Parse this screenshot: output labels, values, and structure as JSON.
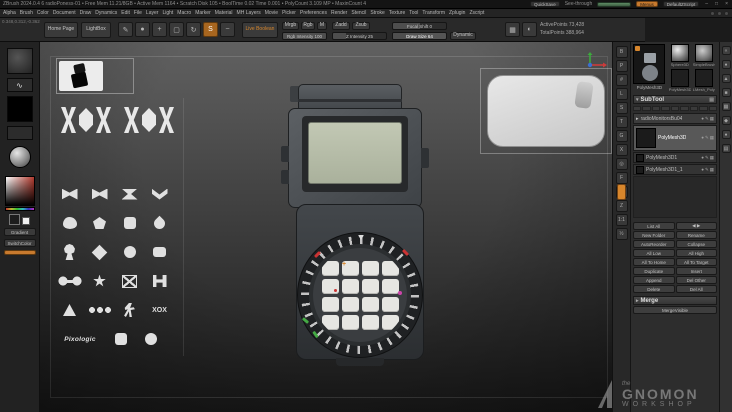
{
  "colors": {
    "accent_orange": "#d7862c",
    "screen_green": "#b8bfab",
    "canvas_top": "#616161",
    "canvas_bottom": "#191919",
    "selection_white": "#e8e8e8",
    "tick_red": "#cc3333",
    "tick_green": "#44aa44",
    "tick_magenta": "#cc44aa"
  },
  "title_bar": {
    "app_info": "ZBrush 2024.0.4 6 radioPoness-01  •  Free Mem 11.21/8GB  •  Active Mem 1164  •  Scratch Disk 105  •  BoolTime 0.02 Time 0.001  •  PolyCount 3.109 MP  •  MaxinCount 4",
    "quicksave": "QuickSave",
    "see_through_label": "See-through",
    "menus_toggle": "Menus",
    "zscript_button": "DefaultZScript",
    "window_minimize": "–",
    "window_maximize": "□",
    "window_close": "×"
  },
  "coords_readout": "0.348,0.312,-0.362",
  "menu_bar": {
    "items": [
      "Alpha",
      "Brush",
      "Color",
      "Document",
      "Draw",
      "Dynamics",
      "Edit",
      "File",
      "Layer",
      "Light",
      "Macro",
      "Marker",
      "Material",
      "MH Layers",
      "Movie",
      "Picker",
      "Preferences",
      "Render",
      "Stencil",
      "Stroke",
      "Texture",
      "Tool",
      "Transform",
      "Zplugin",
      "Zscript"
    ]
  },
  "toolbar": {
    "home_page": "Home Page",
    "lightbox": "LightBox",
    "live_boolean": "Live Boolean",
    "icons": [
      {
        "name": "edit-icon",
        "glyph": "✎"
      },
      {
        "name": "draw-icon",
        "glyph": "●"
      },
      {
        "name": "move-icon",
        "glyph": "+"
      },
      {
        "name": "scale-icon",
        "glyph": "▢"
      },
      {
        "name": "rotate-icon",
        "glyph": "↻"
      },
      {
        "name": "sculptris-icon",
        "glyph": "S",
        "accent": true
      },
      {
        "name": "stroke-icon",
        "glyph": "~"
      }
    ],
    "mrgb": "Mrgb",
    "rgb": "Rgb",
    "m": "M",
    "rgb_slider": "Rgb Intensity 100",
    "zadd": "Zadd",
    "zsub": "Zsub",
    "z_intensity_slider": "Z Intensity 25",
    "focal_shift_slider": "Focal Shift 0",
    "draw_size_slider": "Draw Size 64",
    "dynamic": "Dynamic",
    "right_icons": [
      {
        "name": "polypaint-icon",
        "glyph": "▦"
      },
      {
        "name": "spotlight-icon",
        "glyph": "◐"
      }
    ],
    "active_points": "ActivePoints 73,428",
    "total_points": "TotalPoints 388,964"
  },
  "left_shelf": {
    "gradient_button": "Gradient",
    "switch_color_button": "SwitchColor"
  },
  "alpha_panel": {
    "rows": [
      [
        "logo",
        "logo"
      ],
      [
        "bowtie",
        "bowtie",
        "ribbon",
        "chevron"
      ],
      [
        "blob",
        "pentagon",
        "roundsq",
        "teardrop"
      ],
      [
        "keyhole",
        "diamond",
        "circle",
        "roundsq2"
      ],
      [
        "dumbbell",
        "burst",
        "xbox",
        "hbar"
      ],
      [
        "triangle",
        "chain",
        "runner",
        "xoxsmall"
      ],
      [
        "pixologic",
        "roundsq",
        "circle"
      ]
    ],
    "texts": {
      "xoxsmall": "XOX",
      "pixologic": "Pixologic"
    }
  },
  "model": {
    "keypad_keys": 16
  },
  "right_shelf": {
    "icons": [
      {
        "name": "bpr-render-icon",
        "glyph": "B"
      },
      {
        "name": "perspective-icon",
        "glyph": "P"
      },
      {
        "name": "floor-grid-icon",
        "glyph": "#"
      },
      {
        "name": "local-transform-icon",
        "glyph": "L"
      },
      {
        "name": "symmetry-icon",
        "glyph": "S"
      },
      {
        "name": "transparency-icon",
        "glyph": "T"
      },
      {
        "name": "ghost-icon",
        "glyph": "G"
      },
      {
        "name": "xpose-icon",
        "glyph": "X"
      },
      {
        "name": "solo-icon",
        "glyph": "◎"
      },
      {
        "name": "frame-icon",
        "glyph": "F"
      },
      {
        "name": "move-doc-icon",
        "glyph": "M"
      },
      {
        "name": "zoom-doc-icon",
        "glyph": "Z"
      },
      {
        "name": "actual-size-icon",
        "glyph": "1:1"
      },
      {
        "name": "aa-half-icon",
        "glyph": "½"
      }
    ]
  },
  "tool_palette": {
    "current": "PolyMesh3D",
    "recents": [
      {
        "name": "Sphere3D",
        "style": "sphere"
      },
      {
        "name": "SimpleBrush",
        "style": "blob"
      },
      {
        "name": "PolyMesh3D1",
        "style": "dark"
      },
      {
        "name": "LMesh_PolyMe",
        "style": "dark"
      }
    ]
  },
  "subtool": {
    "header": "SubTool",
    "items": [
      {
        "name": "radioMonitorsBu04",
        "kind": "folder"
      },
      {
        "name": "PolyMesh3D",
        "kind": "mesh",
        "selected": true
      },
      {
        "name": "PolyMesh3D1",
        "kind": "mesh"
      },
      {
        "name": "PolyMesh3D1_1",
        "kind": "mesh"
      }
    ],
    "buttons": [
      [
        "List All",
        "◀ ▶"
      ],
      [
        "New Folder",
        "Rename"
      ],
      [
        "AutoReorder",
        "Collapse"
      ],
      [
        "All Low",
        "All High"
      ],
      [
        "All To Home",
        "All To Target"
      ],
      [
        "Duplicate",
        "Insert"
      ],
      [
        "Append",
        "Del Other"
      ],
      [
        "Delete",
        "Del All"
      ]
    ],
    "merge_header": "Merge",
    "merge_button": "MergeVisible"
  },
  "right_tray": {
    "icons": [
      {
        "name": "tray-collapse-icon",
        "glyph": "«"
      },
      {
        "name": "tray-brush-icon",
        "glyph": "●"
      },
      {
        "name": "tray-stroke-icon",
        "glyph": "▲"
      },
      {
        "name": "tray-alpha-icon",
        "glyph": "■"
      },
      {
        "name": "tray-texture-icon",
        "glyph": "▦"
      },
      {
        "name": "tray-material-icon",
        "glyph": "◆"
      },
      {
        "name": "tray-color-icon",
        "glyph": "●"
      },
      {
        "name": "tray-layers-icon",
        "glyph": "▤"
      }
    ]
  },
  "watermark": {
    "line1": "the",
    "line2": "GNOMON",
    "line3": "WORKSHOP"
  }
}
